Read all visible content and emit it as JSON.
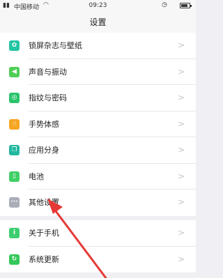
{
  "status_bar": {
    "carrier": "中国移动",
    "time": "09:23"
  },
  "header": {
    "title": "设置"
  },
  "group1": [
    {
      "label": "锁屏杂志与壁纸",
      "icon": "wallpaper-icon",
      "color": "#23c5a4"
    },
    {
      "label": "声音与振动",
      "icon": "sound-icon",
      "color": "#4fcf55"
    },
    {
      "label": "指纹与密码",
      "icon": "fingerprint-icon",
      "color": "#2bc46d"
    },
    {
      "label": "手势体感",
      "icon": "gesture-icon",
      "color": "#f5a623"
    },
    {
      "label": "应用分身",
      "icon": "app-clone-icon",
      "color": "#22b8a0"
    },
    {
      "label": "电池",
      "icon": "battery-icon",
      "color": "#3fcf66"
    },
    {
      "label": "其他设置",
      "icon": "more-icon",
      "color": "#a9aeb8"
    }
  ],
  "group2": [
    {
      "label": "关于手机",
      "icon": "info-icon",
      "color": "#3dce6f"
    },
    {
      "label": "系统更新",
      "icon": "update-icon",
      "color": "#34c759"
    }
  ]
}
